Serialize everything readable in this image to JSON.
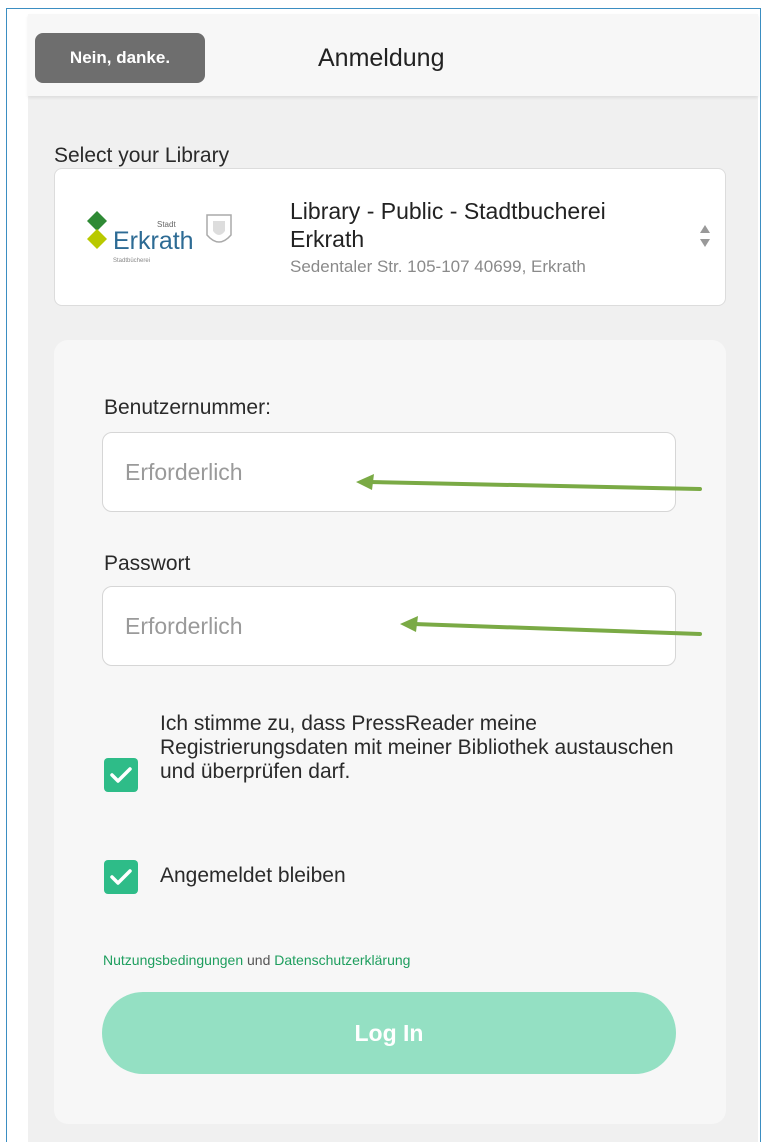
{
  "header": {
    "dismiss_label": "Nein, danke.",
    "title": "Anmeldung"
  },
  "library": {
    "select_label": "Select your Library",
    "name": "Library - Public - Stadtbucherei Erkrath",
    "address": "Sedentaler Str. 105-107 40699, Erkrath",
    "logo": {
      "small_text": "Stadt",
      "text": "Erkrath",
      "subtext": "Stadtbücherei"
    }
  },
  "form": {
    "username_label": "Benutzernummer:",
    "username_placeholder": "Erforderlich",
    "password_label": "Passwort",
    "password_placeholder": "Erforderlich",
    "consent_text": "Ich stimme zu, dass PressReader meine Registrierungsdaten mit meiner Bibliothek austauschen und überprüfen darf.",
    "consent_checked": true,
    "stay_logged_in_text": "Angemeldet bleiben",
    "stay_logged_in_checked": true,
    "terms_link": "Nutzungsbedingungen",
    "terms_and": "und",
    "privacy_link": "Datenschutzerklärung",
    "login_label": "Log In"
  },
  "colors": {
    "accent_green": "#2ebc88",
    "login_button": "#94e0c3",
    "link_green": "#1e9e5e",
    "dismiss_button": "#6e6e6e",
    "annotation_arrow": "#7aaa45"
  },
  "icons": {
    "sort": "sort-arrows-icon",
    "check": "checkmark-icon",
    "annotation": "annotation-arrow-icon"
  }
}
